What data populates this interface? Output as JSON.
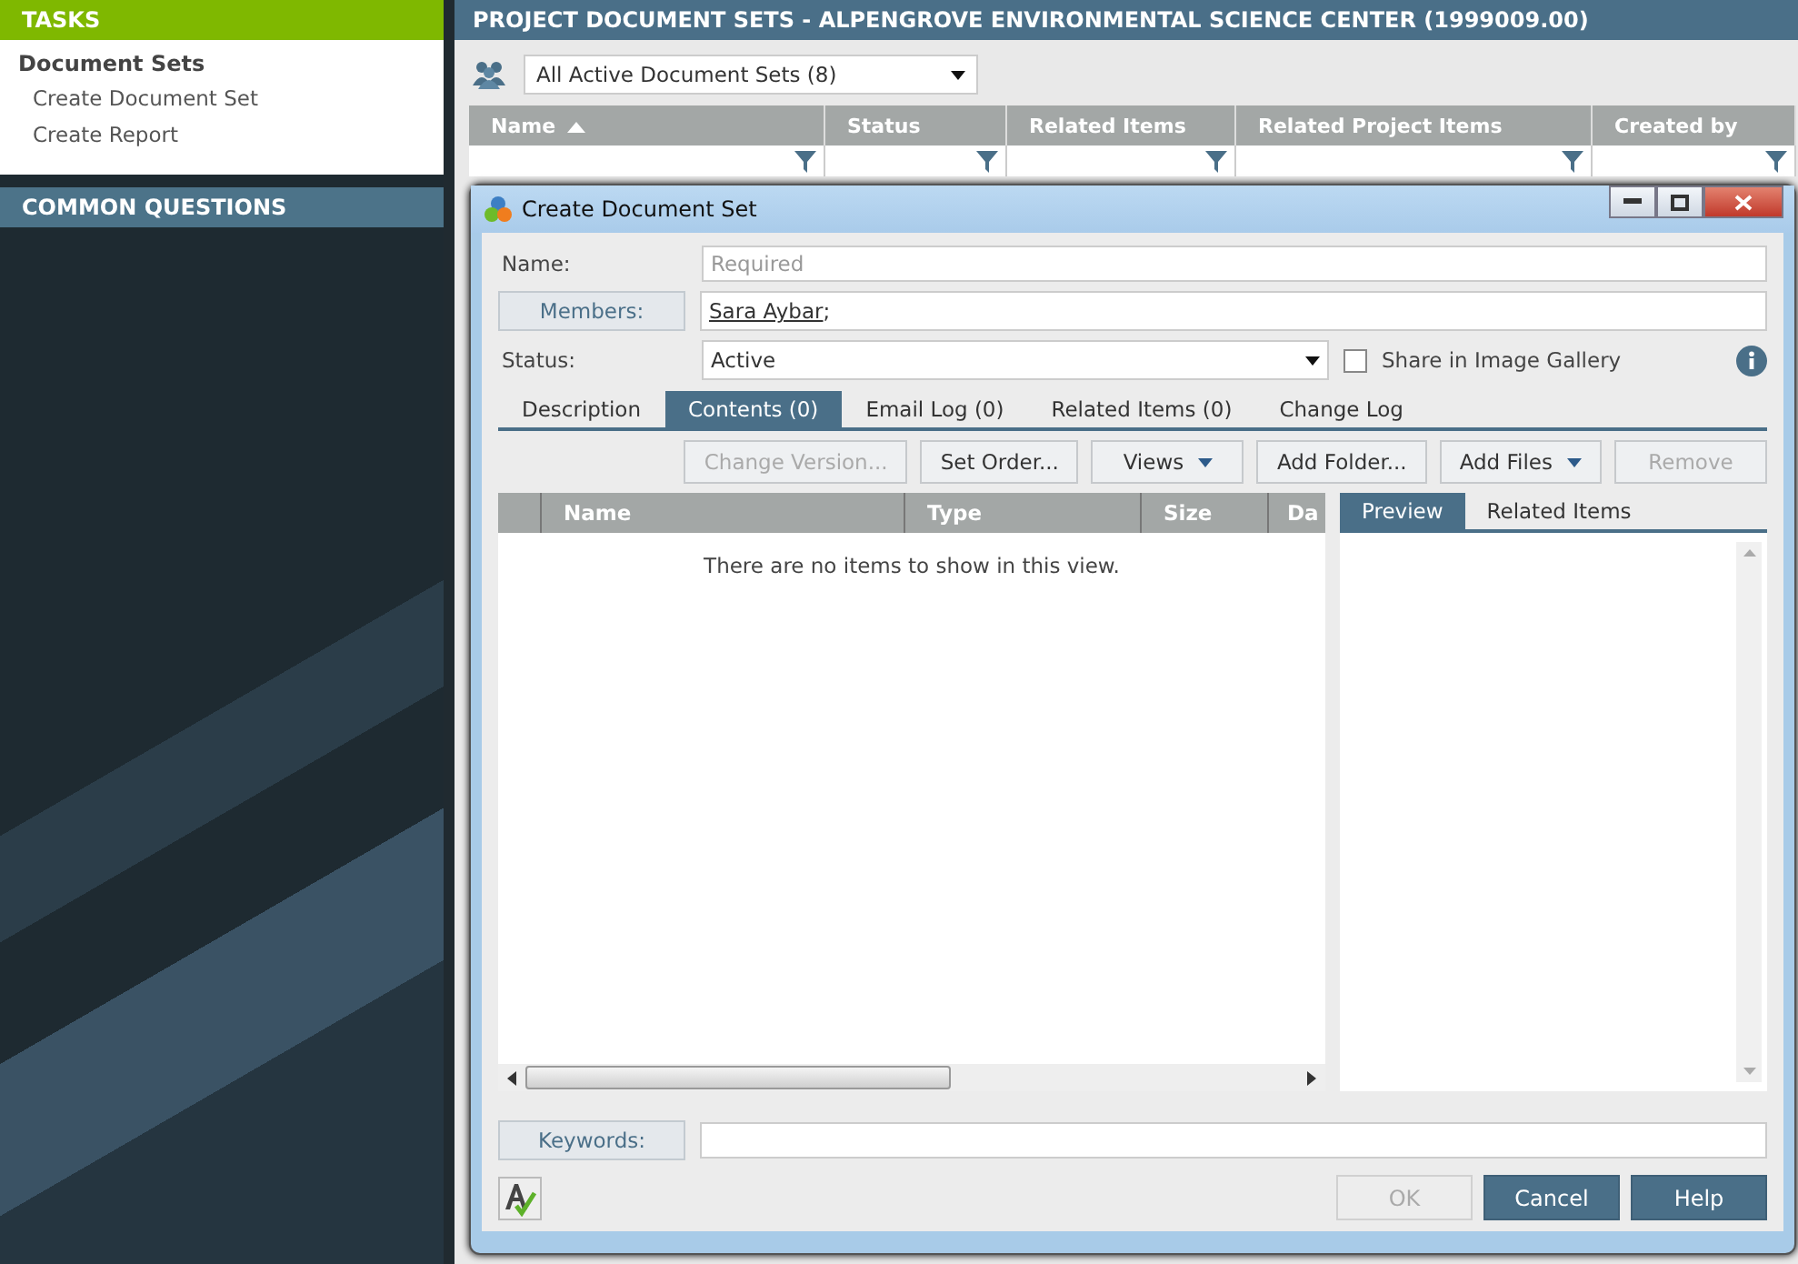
{
  "sidebar": {
    "tasks": {
      "title": "TASKS",
      "section": "Document Sets",
      "items": [
        {
          "label": "Create Document Set"
        },
        {
          "label": "Create Report"
        }
      ]
    },
    "common_questions": {
      "title": "COMMON QUESTIONS"
    }
  },
  "main": {
    "title": "PROJECT DOCUMENT SETS - ALPENGROVE ENVIRONMENTAL SCIENCE CENTER (1999009.00)",
    "view_filter": {
      "value": "All Active Document Sets (8)"
    },
    "columns": [
      {
        "label": "Name",
        "sorted": true
      },
      {
        "label": "Status",
        "sorted": false
      },
      {
        "label": "Related Items",
        "sorted": false
      },
      {
        "label": "Related Project Items",
        "sorted": false
      },
      {
        "label": "Created by",
        "sorted": false
      }
    ]
  },
  "dialog": {
    "title": "Create Document Set",
    "name": {
      "label": "Name:",
      "placeholder": "Required"
    },
    "members": {
      "label": "Members:",
      "names": [
        "Sara Aybar"
      ],
      "separator": ";"
    },
    "status": {
      "label": "Status:",
      "value": "Active"
    },
    "share_in_gallery": {
      "label": "Share in Image Gallery",
      "checked": false
    },
    "tabs": [
      {
        "label": "Description",
        "selected": false
      },
      {
        "label": "Contents (0)",
        "selected": true
      },
      {
        "label": "Email Log (0)",
        "selected": false
      },
      {
        "label": "Related Items (0)",
        "selected": false
      },
      {
        "label": "Change Log",
        "selected": false
      }
    ],
    "toolbar": [
      {
        "label": "Change Version...",
        "kind": "button",
        "disabled": true
      },
      {
        "label": "Set Order...",
        "kind": "button",
        "disabled": false
      },
      {
        "label": "Views",
        "kind": "dropdown",
        "disabled": false
      },
      {
        "label": "Add Folder...",
        "kind": "button",
        "disabled": false
      },
      {
        "label": "Add Files",
        "kind": "dropdown",
        "disabled": false
      },
      {
        "label": "Remove",
        "kind": "button",
        "disabled": true
      }
    ],
    "grid": {
      "columns": [
        "Name",
        "Type",
        "Size",
        "Da"
      ],
      "empty_message": "There are no items to show in this view."
    },
    "side_tabs": [
      {
        "label": "Preview",
        "selected": true
      },
      {
        "label": "Related Items",
        "selected": false
      }
    ],
    "keywords": {
      "label": "Keywords:"
    },
    "buttons": [
      {
        "label": "OK",
        "disabled": true
      },
      {
        "label": "Cancel",
        "disabled": false
      },
      {
        "label": "Help",
        "disabled": false
      }
    ]
  }
}
